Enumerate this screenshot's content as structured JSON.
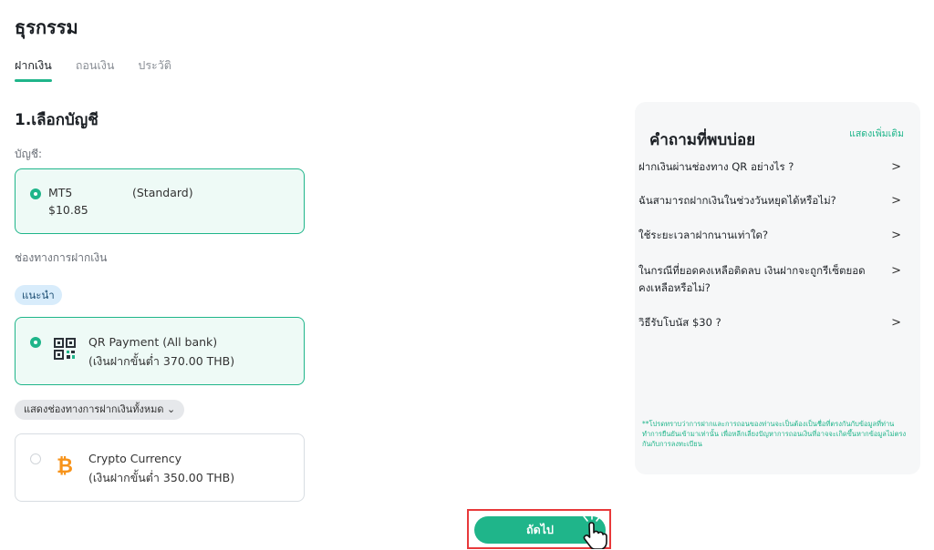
{
  "page": {
    "title": "ธุรกรรม"
  },
  "tabs": [
    {
      "label": "ฝากเงิน",
      "active": true
    },
    {
      "label": "ถอนเงิน",
      "active": false
    },
    {
      "label": "ประวัติ",
      "active": false
    }
  ],
  "account_section": {
    "title": "1.เลือกบัญชี",
    "label": "บัญชี:",
    "account": {
      "name": "MT5",
      "type": "(Standard)",
      "balance": "$10.85",
      "selected": true
    }
  },
  "channels": {
    "label": "ช่องทางการฝากเงิน",
    "recommended_badge": "แนะนำ",
    "methods": [
      {
        "title": "QR Payment (All bank)",
        "min_deposit": "(เงินฝากขั้นต่ำ 370.00 THB)",
        "icon": "qr-code-icon",
        "selected": true
      },
      {
        "title": "Crypto Currency",
        "min_deposit": "(เงินฝากขั้นต่ำ 350.00 THB)",
        "icon": "bitcoin-icon",
        "selected": false
      }
    ],
    "show_all_label": "แสดงช่องทางการฝากเงินทั้งหมด ⌄"
  },
  "next_button": {
    "label": "ถัดไป"
  },
  "faq": {
    "title": "คำถามที่พบบ่อย",
    "more_link": "แสดงเพิ่มเติม",
    "items": [
      {
        "question": "ฝากเงินผ่านช่องทาง QR อย่างไร ?",
        "arrow": ">"
      },
      {
        "question": "ฉันสามารถฝากเงินในช่วงวันหยุดได้หรือไม่?",
        "arrow": ">"
      },
      {
        "question": "ใช้ระยะเวลาฝากนานเท่าใด?",
        "arrow": ">"
      },
      {
        "question": "ในกรณีที่ยอดคงเหลือติดลบ เงินฝากจะถูกรีเซ็ตยอดคงเหลือหรือไม่?",
        "arrow": ">"
      },
      {
        "question": "วิธีรับโบนัส $30 ?",
        "arrow": ">"
      }
    ],
    "note": "**โปรดทราบว่าการฝากและการถอนของท่านจะเป็นต้องเป็นชื่อที่ตรงกันกับข้อมูลที่ท่านทำการยืนยันเข้ามาเท่านั้น เพื่อหลีกเลี่ยงปัญหาการถอนเงินที่อาจจะเกิดขึ้นหากข้อมูลไม่ตรงกันกับการลงทะเบียน"
  },
  "colors": {
    "accent": "#1fb58a",
    "selected_bg": "#eefaf6",
    "badge_bg": "#d8ecfb",
    "highlight_border": "#e8393b",
    "bitcoin": "#f7931a"
  }
}
